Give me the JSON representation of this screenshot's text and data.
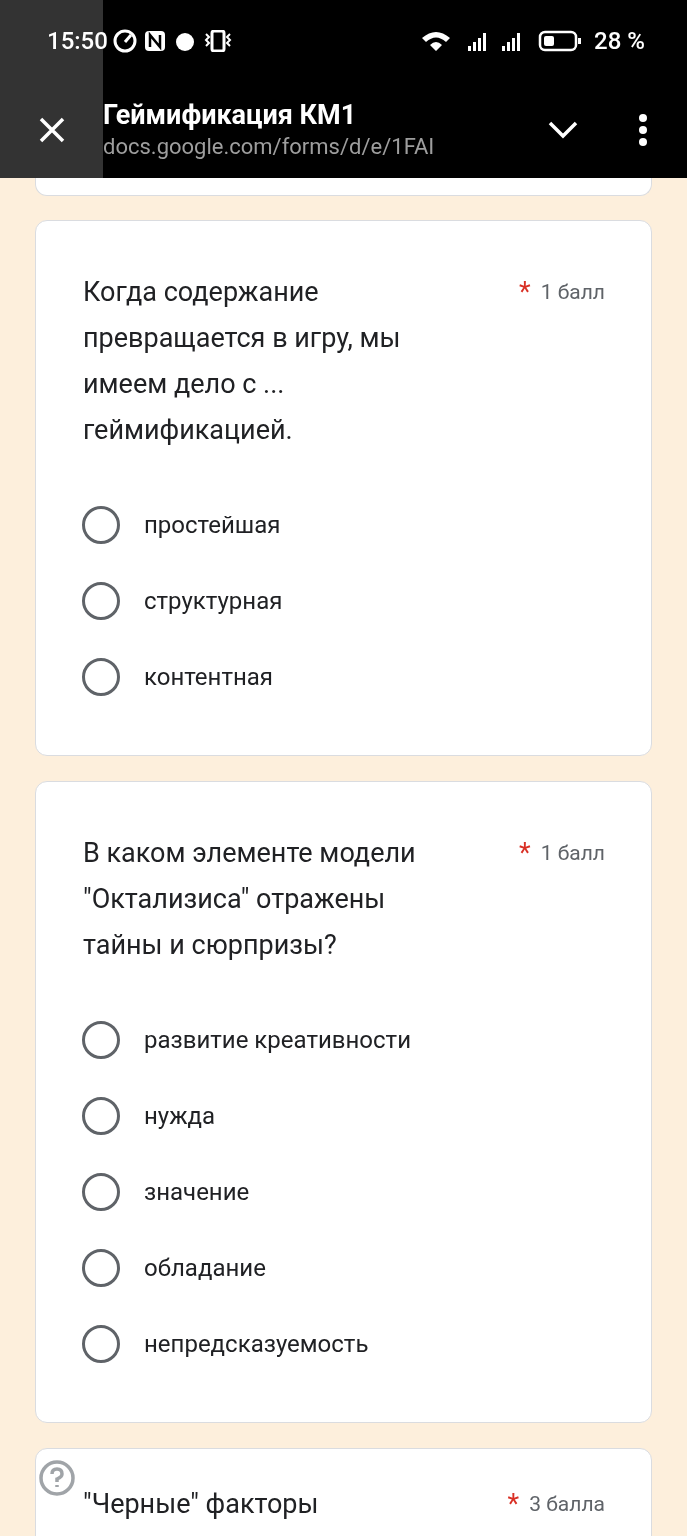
{
  "status_bar": {
    "time": "15:50",
    "battery": "28 %"
  },
  "header": {
    "title": "Геймификация КМ1",
    "url": "docs.google.com/forms/d/e/1FAI"
  },
  "questions": [
    {
      "text": "Когда содержание превращается в игру, мы имеем дело с ... геймификацией.",
      "required_mark": "*",
      "points": "1 балл",
      "has_help": false,
      "options": [
        {
          "label": "простейшая",
          "selected": false
        },
        {
          "label": "структурная",
          "selected": false
        },
        {
          "label": "контентная",
          "selected": false
        }
      ]
    },
    {
      "text": "В каком элементе модели \"Октализиса\" отражены тайны и сюрпризы?",
      "required_mark": "*",
      "points": "1 балл",
      "has_help": false,
      "options": [
        {
          "label": "развитие креативности",
          "selected": false
        },
        {
          "label": "нужда",
          "selected": false
        },
        {
          "label": "значение",
          "selected": false
        },
        {
          "label": "обладание",
          "selected": false
        },
        {
          "label": "непредсказуемость",
          "selected": false
        }
      ]
    },
    {
      "text": "\"Черные\" факторы",
      "required_mark": "*",
      "points": "3 балла",
      "has_help": true
    }
  ]
}
